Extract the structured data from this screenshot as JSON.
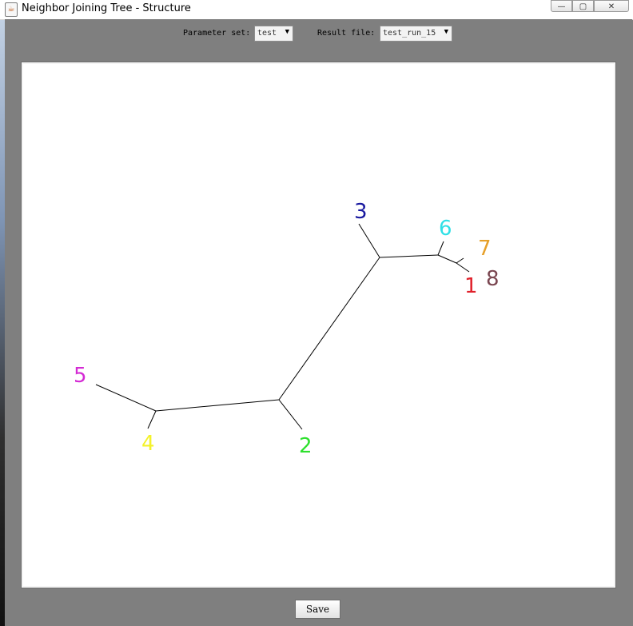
{
  "window": {
    "title": "Neighbor Joining Tree - Structure",
    "app_icon": "java-cup-icon",
    "controls": {
      "minimize": "—",
      "maximize": "▢",
      "close": "✕"
    }
  },
  "toolbar": {
    "parameter_label": "Parameter set:",
    "parameter_value": "test",
    "result_label": "Result file:",
    "result_value": "test_run_15",
    "dropdown_arrow": "▼"
  },
  "tree": {
    "leaves": [
      {
        "id": "1",
        "color": "#e0212b"
      },
      {
        "id": "2",
        "color": "#2ee02e"
      },
      {
        "id": "3",
        "color": "#1a1aa0"
      },
      {
        "id": "4",
        "color": "#f4f22a"
      },
      {
        "id": "5",
        "color": "#d42ad4"
      },
      {
        "id": "6",
        "color": "#2fe0e6"
      },
      {
        "id": "7",
        "color": "#e6a02a"
      },
      {
        "id": "8",
        "color": "#7a4650"
      }
    ]
  },
  "footer": {
    "save_label": "Save"
  }
}
